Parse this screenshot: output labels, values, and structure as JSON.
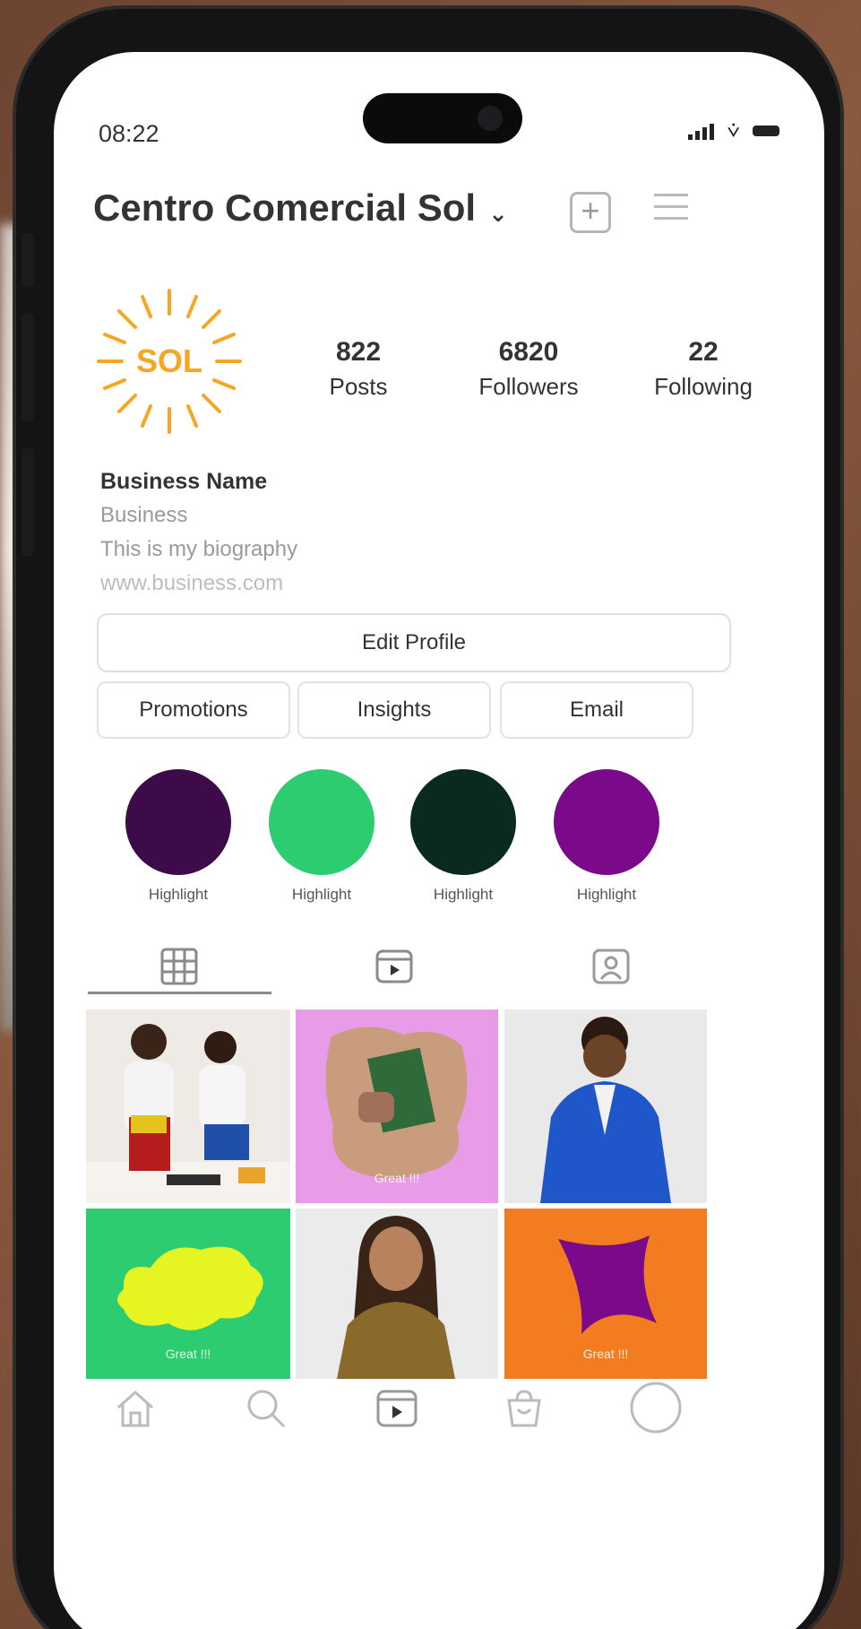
{
  "status_bar": {
    "time": "08:22"
  },
  "header": {
    "title": "Centro Comercial Sol"
  },
  "logo": {
    "text": "SOL",
    "color": "#f6a623"
  },
  "stats": [
    {
      "value": "822",
      "label": "Posts"
    },
    {
      "value": "6820",
      "label": "Followers"
    },
    {
      "value": "22",
      "label": "Following"
    }
  ],
  "bio": {
    "name": "Business Name",
    "category": "Business",
    "text": "This is my biography",
    "link": "www.business.com"
  },
  "buttons": {
    "edit_profile": "Edit Profile",
    "promotions": "Promotions",
    "insights": "Insights",
    "email": "Email"
  },
  "highlights": [
    {
      "label": "Highlight",
      "color": "#3d0a4a"
    },
    {
      "label": "Highlight",
      "color": "#2ecc71"
    },
    {
      "label": "Highlight",
      "color": "#0a2a1e"
    },
    {
      "label": "Highlight",
      "color": "#7b0a8a"
    }
  ],
  "posts": [
    {
      "type": "photo",
      "description_icon": "people-photo"
    },
    {
      "type": "graphic",
      "caption": "Great !!!",
      "bg": "#e89ce8"
    },
    {
      "type": "photo",
      "description_icon": "person-photo"
    },
    {
      "type": "graphic",
      "caption": "Great !!!",
      "bg": "#2ecc71"
    },
    {
      "type": "photo",
      "description_icon": "person-photo"
    },
    {
      "type": "graphic",
      "caption": "Great !!!",
      "bg": "#f47c20"
    }
  ],
  "colors": {
    "accent_orange": "#f6a623",
    "grid_tab_active": "#8a8a8a"
  }
}
